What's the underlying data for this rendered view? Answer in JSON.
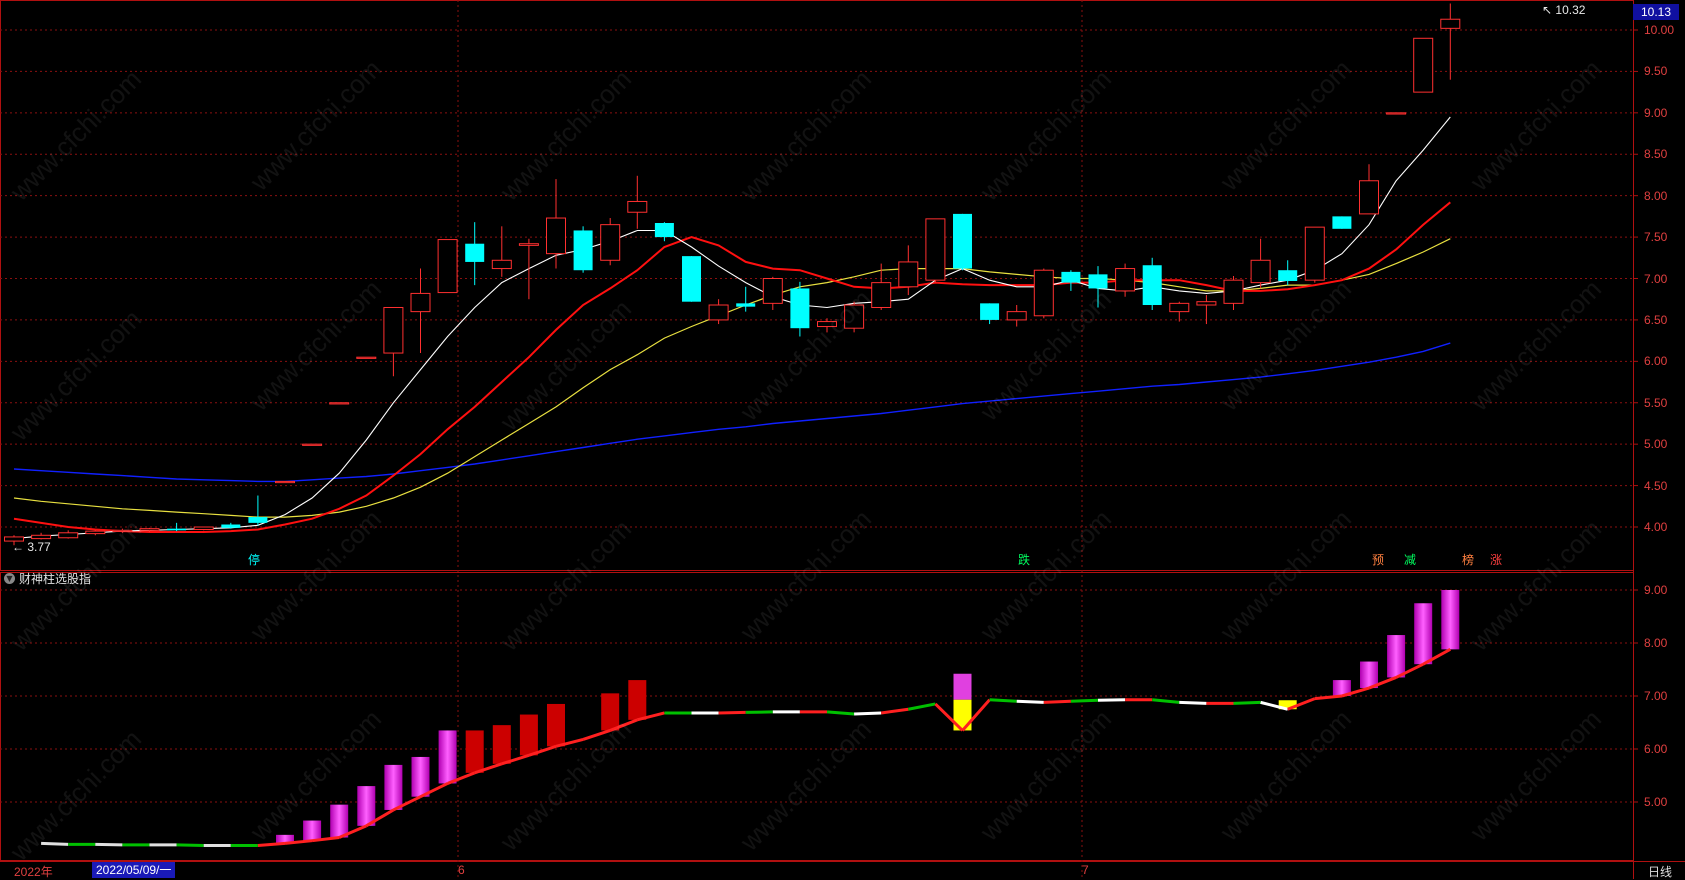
{
  "colors": {
    "up": "#ff3030",
    "down": "#00ffff",
    "ma5": "#ffffff",
    "ma10": "#ff1010",
    "ma20": "#e8e040",
    "ma60": "#1020ff",
    "grid": "#8a1010",
    "bar_red": "#cc0000",
    "bar_magenta": "#ff00ff",
    "bar_yellow": "#ffff00"
  },
  "main_chart": {
    "hi_label": "10.32",
    "lo_label": "3.77",
    "current_price": "10.13",
    "y_ticks": [
      "10.00",
      "9.50",
      "9.00",
      "8.50",
      "8.00",
      "7.50",
      "7.00",
      "6.50",
      "6.00",
      "5.50",
      "5.00",
      "4.50",
      "4.00"
    ],
    "signals": [
      {
        "text": "停",
        "color": "#00ffff"
      },
      {
        "text": "跌",
        "color": "#00ff60"
      },
      {
        "text": "预",
        "color": "#ff8040"
      },
      {
        "text": "减",
        "color": "#00ff60"
      },
      {
        "text": "榜",
        "color": "#ff8040"
      },
      {
        "text": "涨",
        "color": "#ff4040"
      }
    ]
  },
  "indicator": {
    "title": "财神柱选股指",
    "icon": "chevron-down-icon",
    "y_ticks": [
      "9.00",
      "8.00",
      "7.00",
      "6.00",
      "5.00"
    ]
  },
  "x_axis": {
    "year_label": "2022年",
    "selected_date": "2022/05/09/一",
    "month_labels": [
      "6",
      "7"
    ],
    "period": "日线"
  },
  "watermark": "www.cfchi.com",
  "candles": [
    [
      3.83,
      3.88,
      3.78,
      3.9
    ],
    [
      3.86,
      3.9,
      3.85,
      3.93
    ],
    [
      3.87,
      3.93,
      3.86,
      3.96
    ],
    [
      3.92,
      3.95,
      3.9,
      3.96
    ],
    [
      3.95,
      3.96,
      3.93,
      3.98
    ],
    [
      3.96,
      3.98,
      3.94,
      3.99
    ],
    [
      3.98,
      3.96,
      3.95,
      4.05
    ],
    [
      3.97,
      4.0,
      3.96,
      4.0
    ],
    [
      4.03,
      3.99,
      3.98,
      4.05
    ],
    [
      4.12,
      4.05,
      4.02,
      4.38
    ],
    [
      4.55,
      4.55,
      4.55,
      4.55
    ],
    [
      5.0,
      5.0,
      5.0,
      5.0
    ],
    [
      5.5,
      5.5,
      5.5,
      5.5
    ],
    [
      6.05,
      6.05,
      6.05,
      6.05
    ],
    [
      6.1,
      6.65,
      5.82,
      6.65
    ],
    [
      6.6,
      6.82,
      6.1,
      7.12
    ],
    [
      6.83,
      7.47,
      6.83,
      7.47
    ],
    [
      7.42,
      7.2,
      6.92,
      7.68
    ],
    [
      7.12,
      7.22,
      7.02,
      7.63
    ],
    [
      7.4,
      7.42,
      6.75,
      7.48
    ],
    [
      7.3,
      7.73,
      7.12,
      8.2
    ],
    [
      7.58,
      7.1,
      7.07,
      7.63
    ],
    [
      7.22,
      7.65,
      7.16,
      7.73
    ],
    [
      7.8,
      7.93,
      7.6,
      8.24
    ],
    [
      7.67,
      7.5,
      7.45,
      7.68
    ],
    [
      7.27,
      6.72,
      6.72,
      7.27
    ],
    [
      6.5,
      6.68,
      6.45,
      6.75
    ],
    [
      6.7,
      6.66,
      6.6,
      6.9
    ],
    [
      6.7,
      7.0,
      6.62,
      7.02
    ],
    [
      6.88,
      6.4,
      6.3,
      6.96
    ],
    [
      6.42,
      6.48,
      6.35,
      6.52
    ],
    [
      6.4,
      6.68,
      6.35,
      6.72
    ],
    [
      6.65,
      6.95,
      6.62,
      7.18
    ],
    [
      6.9,
      7.2,
      6.8,
      7.4
    ],
    [
      6.98,
      7.72,
      6.95,
      7.72
    ],
    [
      7.78,
      7.12,
      7.1,
      7.78
    ],
    [
      6.7,
      6.5,
      6.45,
      6.7
    ],
    [
      6.5,
      6.6,
      6.42,
      6.68
    ],
    [
      6.55,
      7.1,
      6.52,
      7.12
    ],
    [
      7.08,
      6.95,
      6.85,
      7.1
    ],
    [
      7.05,
      6.88,
      6.65,
      7.15
    ],
    [
      6.85,
      7.12,
      6.78,
      7.18
    ],
    [
      7.16,
      6.68,
      6.62,
      7.25
    ],
    [
      6.6,
      6.7,
      6.48,
      6.72
    ],
    [
      6.68,
      6.72,
      6.45,
      6.8
    ],
    [
      6.7,
      6.98,
      6.62,
      7.03
    ],
    [
      6.95,
      7.22,
      6.88,
      7.48
    ],
    [
      7.1,
      6.97,
      6.92,
      7.22
    ],
    [
      6.98,
      7.62,
      6.95,
      7.62
    ],
    [
      7.75,
      7.6,
      7.6,
      7.75
    ],
    [
      7.78,
      8.18,
      7.78,
      8.38
    ],
    [
      9.0,
      9.0,
      9.0,
      9.0
    ],
    [
      9.25,
      9.9,
      9.25,
      9.9
    ],
    [
      10.02,
      10.13,
      9.4,
      10.32
    ]
  ],
  "indicator_bars": [
    [
      0,
      4.22,
      4.22,
      "line"
    ],
    [
      1,
      4.2,
      4.2,
      "line"
    ],
    [
      2,
      4.2,
      4.2,
      "line"
    ],
    [
      3,
      4.19,
      4.19,
      "line"
    ],
    [
      4,
      4.19,
      4.19,
      "line"
    ],
    [
      5,
      4.19,
      4.19,
      "line"
    ],
    [
      6,
      4.18,
      4.18,
      "line"
    ],
    [
      7,
      4.18,
      4.18,
      "line"
    ],
    [
      8,
      4.18,
      4.18,
      "line"
    ],
    [
      9,
      4.22,
      4.38,
      "mag"
    ],
    [
      10,
      4.27,
      4.65,
      "mag"
    ],
    [
      11,
      4.33,
      4.95,
      "mag"
    ],
    [
      12,
      4.55,
      5.3,
      "mag"
    ],
    [
      13,
      4.85,
      5.7,
      "mag"
    ],
    [
      14,
      5.1,
      5.85,
      "mag"
    ],
    [
      15,
      5.35,
      6.35,
      "mag"
    ],
    [
      16,
      5.55,
      6.35,
      "red"
    ],
    [
      17,
      5.72,
      6.45,
      "red"
    ],
    [
      18,
      5.88,
      6.65,
      "red"
    ],
    [
      19,
      6.05,
      6.85,
      "red"
    ],
    [
      20,
      6.18,
      6.18,
      "line"
    ],
    [
      21,
      6.35,
      7.05,
      "red"
    ],
    [
      22,
      6.55,
      7.3,
      "red"
    ],
    [
      23,
      6.68,
      6.68,
      "line"
    ],
    [
      24,
      6.68,
      6.68,
      "line"
    ],
    [
      25,
      6.68,
      6.68,
      "line"
    ],
    [
      26,
      6.69,
      6.69,
      "line"
    ],
    [
      27,
      6.7,
      6.7,
      "line"
    ],
    [
      28,
      6.7,
      6.7,
      "line"
    ],
    [
      29,
      6.7,
      6.7,
      "line"
    ],
    [
      30,
      6.66,
      6.66,
      "line"
    ],
    [
      31,
      6.68,
      6.68,
      "line"
    ],
    [
      32,
      6.75,
      6.75,
      "line"
    ],
    [
      33,
      6.85,
      6.85,
      "line"
    ],
    [
      34,
      6.35,
      7.42,
      "ymag"
    ],
    [
      35,
      6.93,
      6.93,
      "line"
    ],
    [
      36,
      6.9,
      6.9,
      "line"
    ],
    [
      37,
      6.88,
      6.88,
      "line"
    ],
    [
      38,
      6.9,
      6.9,
      "line"
    ],
    [
      39,
      6.92,
      6.92,
      "line"
    ],
    [
      40,
      6.93,
      6.93,
      "line"
    ],
    [
      41,
      6.93,
      6.93,
      "line"
    ],
    [
      42,
      6.88,
      6.88,
      "line"
    ],
    [
      43,
      6.86,
      6.86,
      "line"
    ],
    [
      44,
      6.86,
      6.86,
      "line"
    ],
    [
      45,
      6.88,
      6.88,
      "line"
    ],
    [
      46,
      6.75,
      6.92,
      "yel"
    ],
    [
      47,
      6.95,
      6.95,
      "line"
    ],
    [
      48,
      7.0,
      7.3,
      "mag"
    ],
    [
      49,
      7.15,
      7.65,
      "mag"
    ],
    [
      50,
      7.35,
      8.15,
      "mag"
    ],
    [
      51,
      7.6,
      8.75,
      "mag"
    ],
    [
      52,
      7.88,
      9.0,
      "mag"
    ]
  ],
  "ma": {
    "ma5": [
      3.86,
      3.89,
      3.91,
      3.93,
      3.95,
      3.96,
      3.97,
      3.98,
      3.99,
      4.02,
      4.15,
      4.35,
      4.65,
      5.05,
      5.5,
      5.9,
      6.3,
      6.65,
      6.95,
      7.12,
      7.28,
      7.35,
      7.45,
      7.58,
      7.58,
      7.38,
      7.15,
      6.95,
      6.78,
      6.68,
      6.65,
      6.7,
      6.72,
      6.75,
      6.98,
      7.12,
      6.98,
      6.9,
      6.9,
      6.98,
      6.88,
      6.85,
      6.9,
      6.85,
      6.82,
      6.85,
      6.92,
      6.98,
      7.1,
      7.3,
      7.65,
      8.18,
      8.55,
      8.95
    ],
    "ma10": [
      4.1,
      4.05,
      4.0,
      3.97,
      3.95,
      3.94,
      3.94,
      3.94,
      3.95,
      3.97,
      4.03,
      4.1,
      4.22,
      4.38,
      4.62,
      4.88,
      5.18,
      5.45,
      5.75,
      6.05,
      6.38,
      6.68,
      6.88,
      7.1,
      7.38,
      7.5,
      7.4,
      7.2,
      7.12,
      7.1,
      7.0,
      6.9,
      6.88,
      6.9,
      6.95,
      6.93,
      6.92,
      6.92,
      6.92,
      6.95,
      6.95,
      6.98,
      6.98,
      6.98,
      6.92,
      6.85,
      6.85,
      6.87,
      6.92,
      6.98,
      7.12,
      7.35,
      7.65,
      7.92
    ],
    "ma20": [
      4.35,
      4.31,
      4.28,
      4.25,
      4.22,
      4.2,
      4.18,
      4.16,
      4.14,
      4.12,
      4.12,
      4.14,
      4.18,
      4.25,
      4.35,
      4.48,
      4.65,
      4.85,
      5.05,
      5.25,
      5.45,
      5.68,
      5.9,
      6.08,
      6.28,
      6.42,
      6.55,
      6.68,
      6.8,
      6.9,
      6.95,
      7.02,
      7.1,
      7.12,
      7.12,
      7.12,
      7.08,
      7.05,
      7.02,
      7.0,
      7.0,
      6.98,
      6.95,
      6.9,
      6.85,
      6.85,
      6.88,
      6.92,
      6.92,
      6.98,
      7.05,
      7.18,
      7.32,
      7.48
    ],
    "ma60": [
      4.7,
      4.68,
      4.66,
      4.64,
      4.62,
      4.6,
      4.58,
      4.57,
      4.56,
      4.55,
      4.55,
      4.57,
      4.59,
      4.61,
      4.64,
      4.68,
      4.72,
      4.76,
      4.81,
      4.86,
      4.91,
      4.96,
      5.01,
      5.06,
      5.1,
      5.14,
      5.18,
      5.21,
      5.25,
      5.28,
      5.31,
      5.34,
      5.37,
      5.41,
      5.45,
      5.49,
      5.52,
      5.55,
      5.58,
      5.61,
      5.64,
      5.67,
      5.7,
      5.72,
      5.75,
      5.78,
      5.81,
      5.85,
      5.89,
      5.94,
      5.99,
      6.05,
      6.12,
      6.22
    ]
  }
}
